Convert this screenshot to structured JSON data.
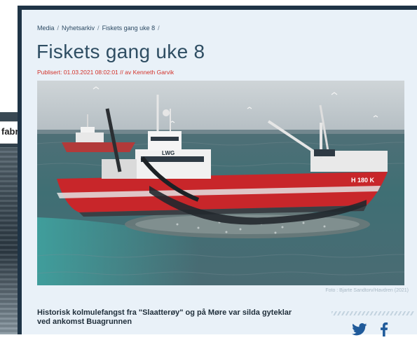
{
  "background_page": {
    "title_fragment": "fabr"
  },
  "breadcrumb": [
    {
      "label": "Media"
    },
    {
      "label": "Nyhetsarkiv"
    },
    {
      "label": "Fiskets gang uke 8"
    }
  ],
  "breadcrumb_separator": "/",
  "article": {
    "title": "Fiskets gang uke 8",
    "byline": "Publisert: 01.03.2021 08:02:01 // av Kenneth Garvik",
    "photo": {
      "hull_number": "H 180 K",
      "wheelhouse_text": "LWG"
    },
    "photo_credit": "Foto : Bjarte Sandtorv/Havdren (2021)",
    "lead": "Historisk kolmulefangst fra \"Slaatterøy\" og på Møre var silda gyteklar ved ankomst Buagrunnen"
  },
  "share": {
    "icons": [
      "twitter-icon",
      "facebook-icon"
    ]
  },
  "colors": {
    "window_frame": "#1f3446",
    "panel_bg": "#e9f1f8",
    "title": "#2f4e63",
    "byline": "#d3322a",
    "share_icon": "#1f5a9a",
    "hull_red": "#c8262a"
  }
}
